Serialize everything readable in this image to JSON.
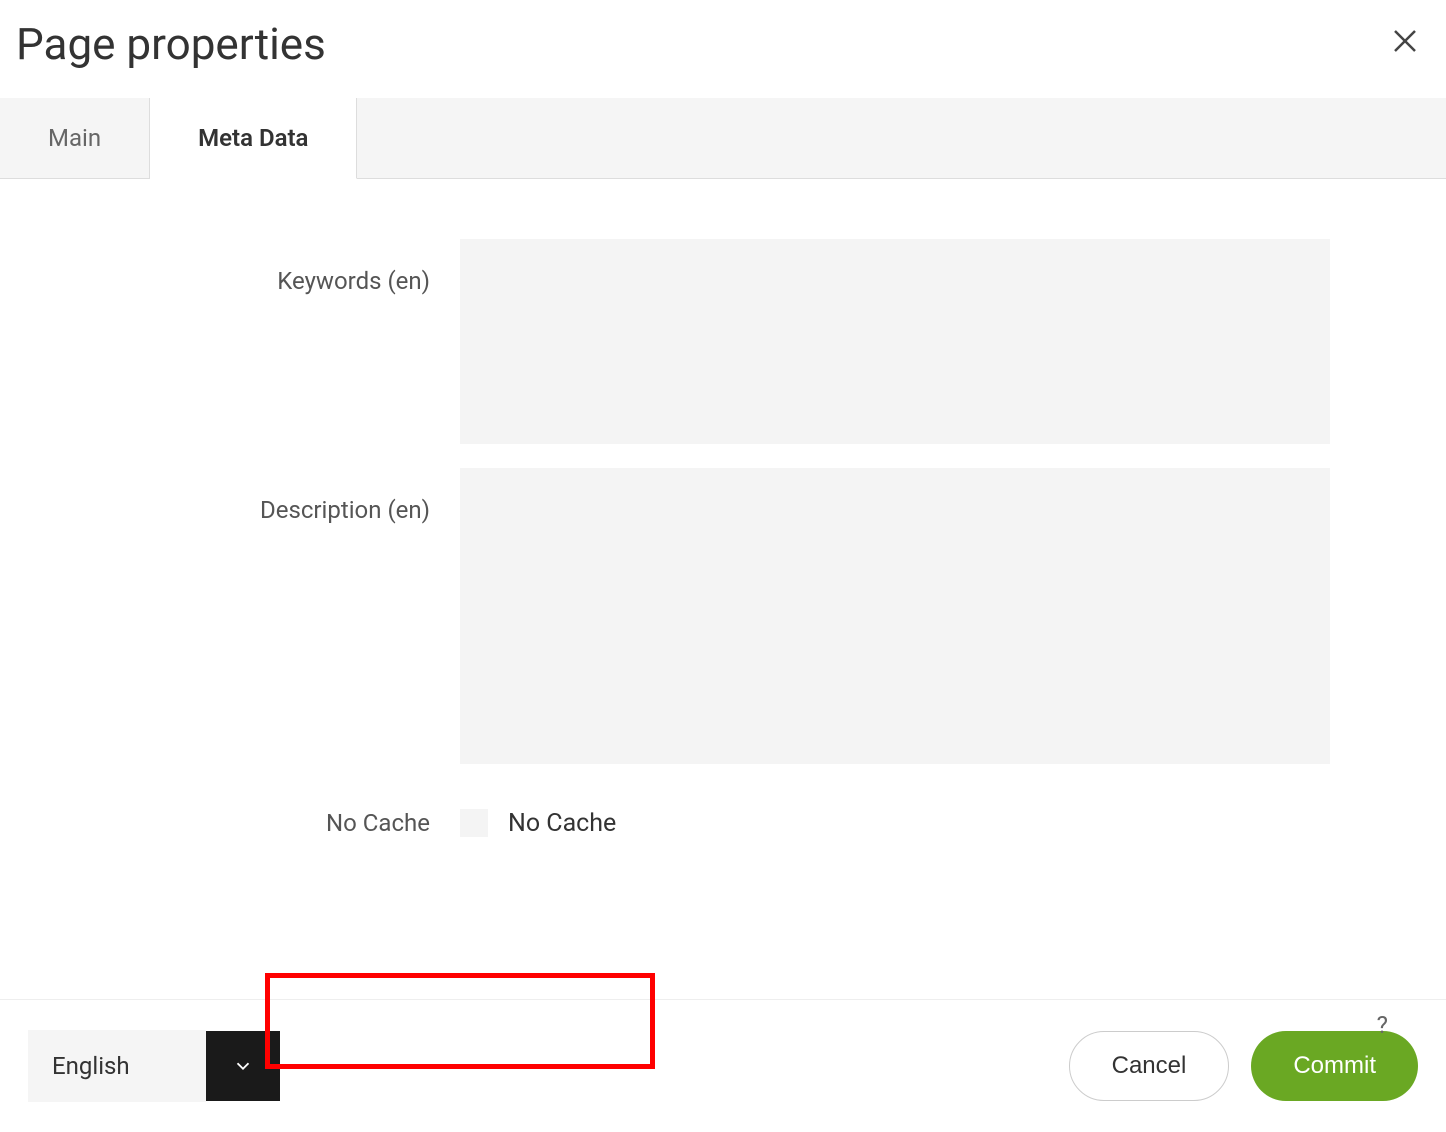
{
  "header": {
    "title": "Page properties"
  },
  "tabs": [
    {
      "label": "Main",
      "active": false
    },
    {
      "label": "Meta Data",
      "active": true
    }
  ],
  "form": {
    "keywords": {
      "label": "Keywords (en)",
      "value": ""
    },
    "description": {
      "label": "Description (en)",
      "value": ""
    },
    "noCache": {
      "label": "No Cache",
      "checkboxLabel": "No Cache",
      "checked": false
    }
  },
  "help": {
    "symbol": "?"
  },
  "footer": {
    "language": {
      "selected": "English"
    },
    "cancel": "Cancel",
    "commit": "Commit"
  }
}
